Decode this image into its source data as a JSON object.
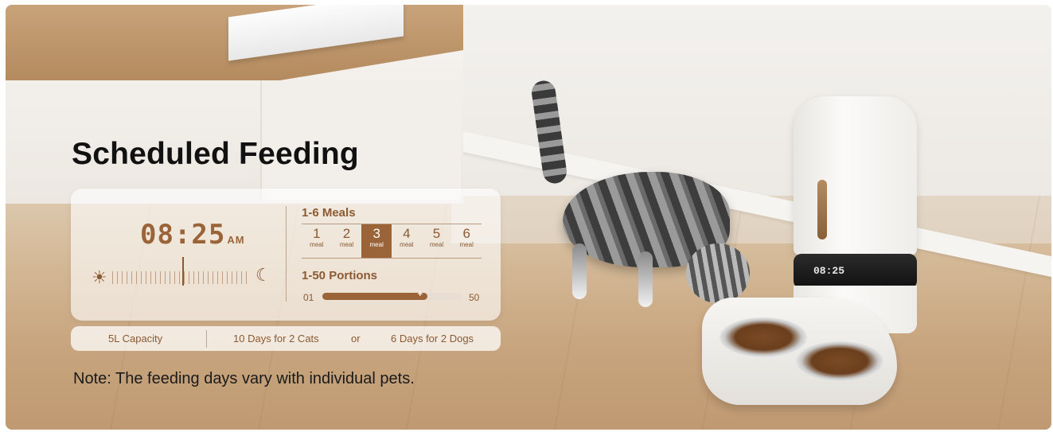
{
  "headline": "Scheduled Feeding",
  "clock": {
    "time": "08:25",
    "ampm": "AM"
  },
  "icons": {
    "day": "sun-icon",
    "night": "moon-icon"
  },
  "meals": {
    "label": "1-6 Meals",
    "options": [
      {
        "num": "1",
        "unit": "meal"
      },
      {
        "num": "2",
        "unit": "meal"
      },
      {
        "num": "3",
        "unit": "meal"
      },
      {
        "num": "4",
        "unit": "meal"
      },
      {
        "num": "5",
        "unit": "meal"
      },
      {
        "num": "6",
        "unit": "meal"
      }
    ],
    "selected": "3"
  },
  "portions": {
    "label": "1-50 Portions",
    "min": "01",
    "max": "50",
    "level_fraction": 0.75,
    "knob_symbol": "+"
  },
  "stats": {
    "capacity": "5L Capacity",
    "cats": "10 Days for 2 Cats",
    "or": "or",
    "dogs": "6 Days for 2 Dogs"
  },
  "note": "Note: The feeding days vary with individual pets.",
  "device_display": "08:25",
  "colors": {
    "accent": "#9a6438",
    "text_brown": "#8a5a33"
  }
}
